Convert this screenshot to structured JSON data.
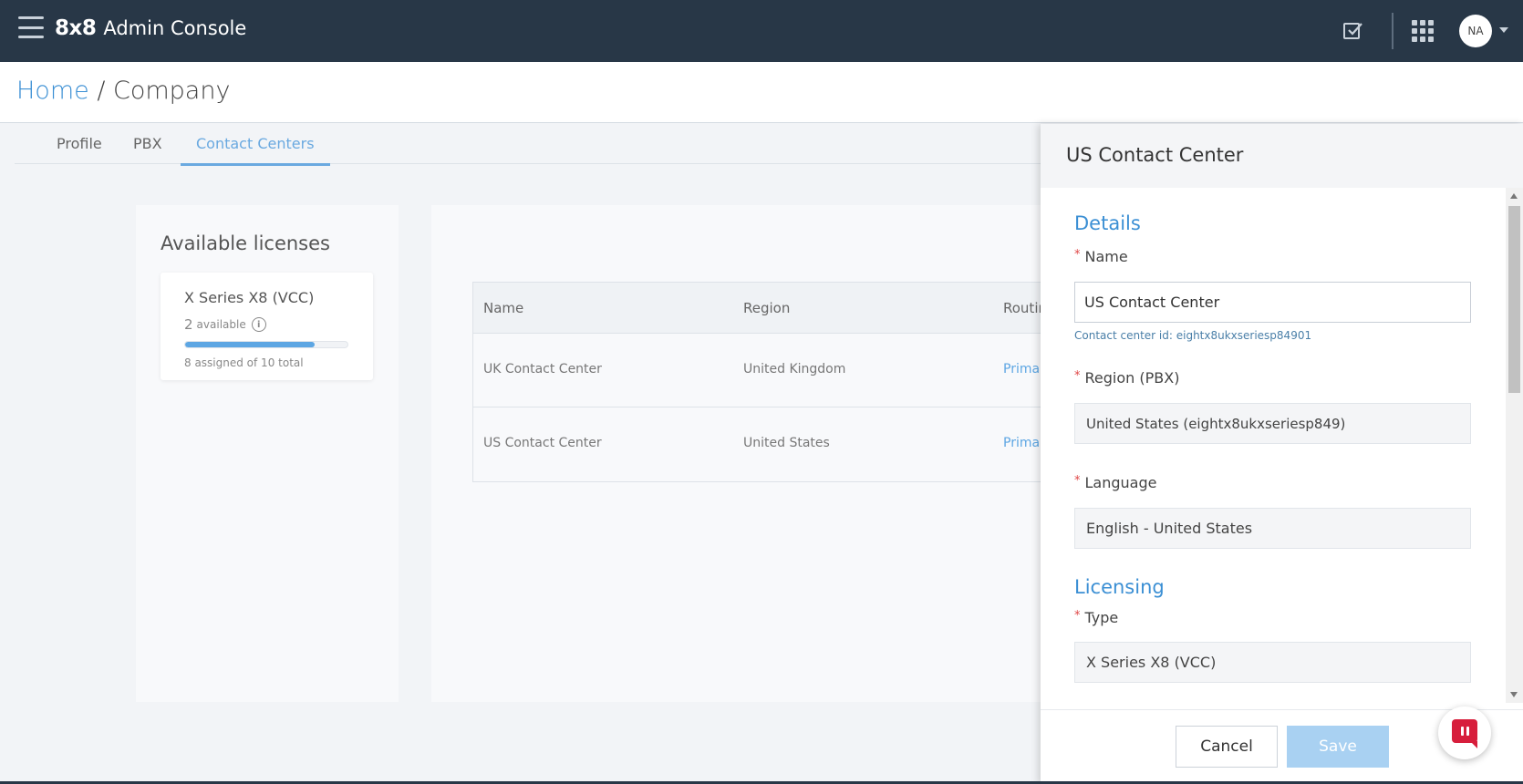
{
  "app": {
    "logo": "8x8",
    "title": "Admin Console",
    "user_initials": "NA"
  },
  "breadcrumb": {
    "home": "Home",
    "separator": " / ",
    "current": "Company"
  },
  "tabs": [
    {
      "label": "Profile",
      "active": false
    },
    {
      "label": "PBX",
      "active": false
    },
    {
      "label": "Contact Centers",
      "active": true
    }
  ],
  "licenses": {
    "title": "Available licenses",
    "card": {
      "name": "X Series X8 (VCC)",
      "available_count": "2",
      "available_label": "available",
      "assigned_text": "8 assigned of 10 total",
      "assigned": 8,
      "total": 10
    }
  },
  "table": {
    "headers": [
      "Name",
      "Region",
      "Routin"
    ],
    "rows": [
      {
        "name": "UK Contact Center",
        "region": "United Kingdom",
        "routing": "Primar"
      },
      {
        "name": "US Contact Center",
        "region": "United States",
        "routing": "Primar"
      }
    ]
  },
  "drawer": {
    "title": "US Contact Center",
    "details_heading": "Details",
    "name_label": "Name",
    "name_value": "US Contact Center",
    "contact_center_id": "Contact center id: eightx8ukxseriesp84901",
    "region_label": "Region (PBX)",
    "region_value": "United States (eightx8ukxseriesp849)",
    "language_label": "Language",
    "language_value": "English - United States",
    "licensing_heading": "Licensing",
    "type_label": "Type",
    "type_value": "X Series X8 (VCC)",
    "required_mark": "*",
    "cancel_label": "Cancel",
    "save_label": "Save"
  },
  "colors": {
    "topbar": "#283747",
    "accent": "#3b8fd4",
    "save_disabled": "#a9d1f2",
    "required": "#e04848",
    "chat": "#d71e3c"
  }
}
